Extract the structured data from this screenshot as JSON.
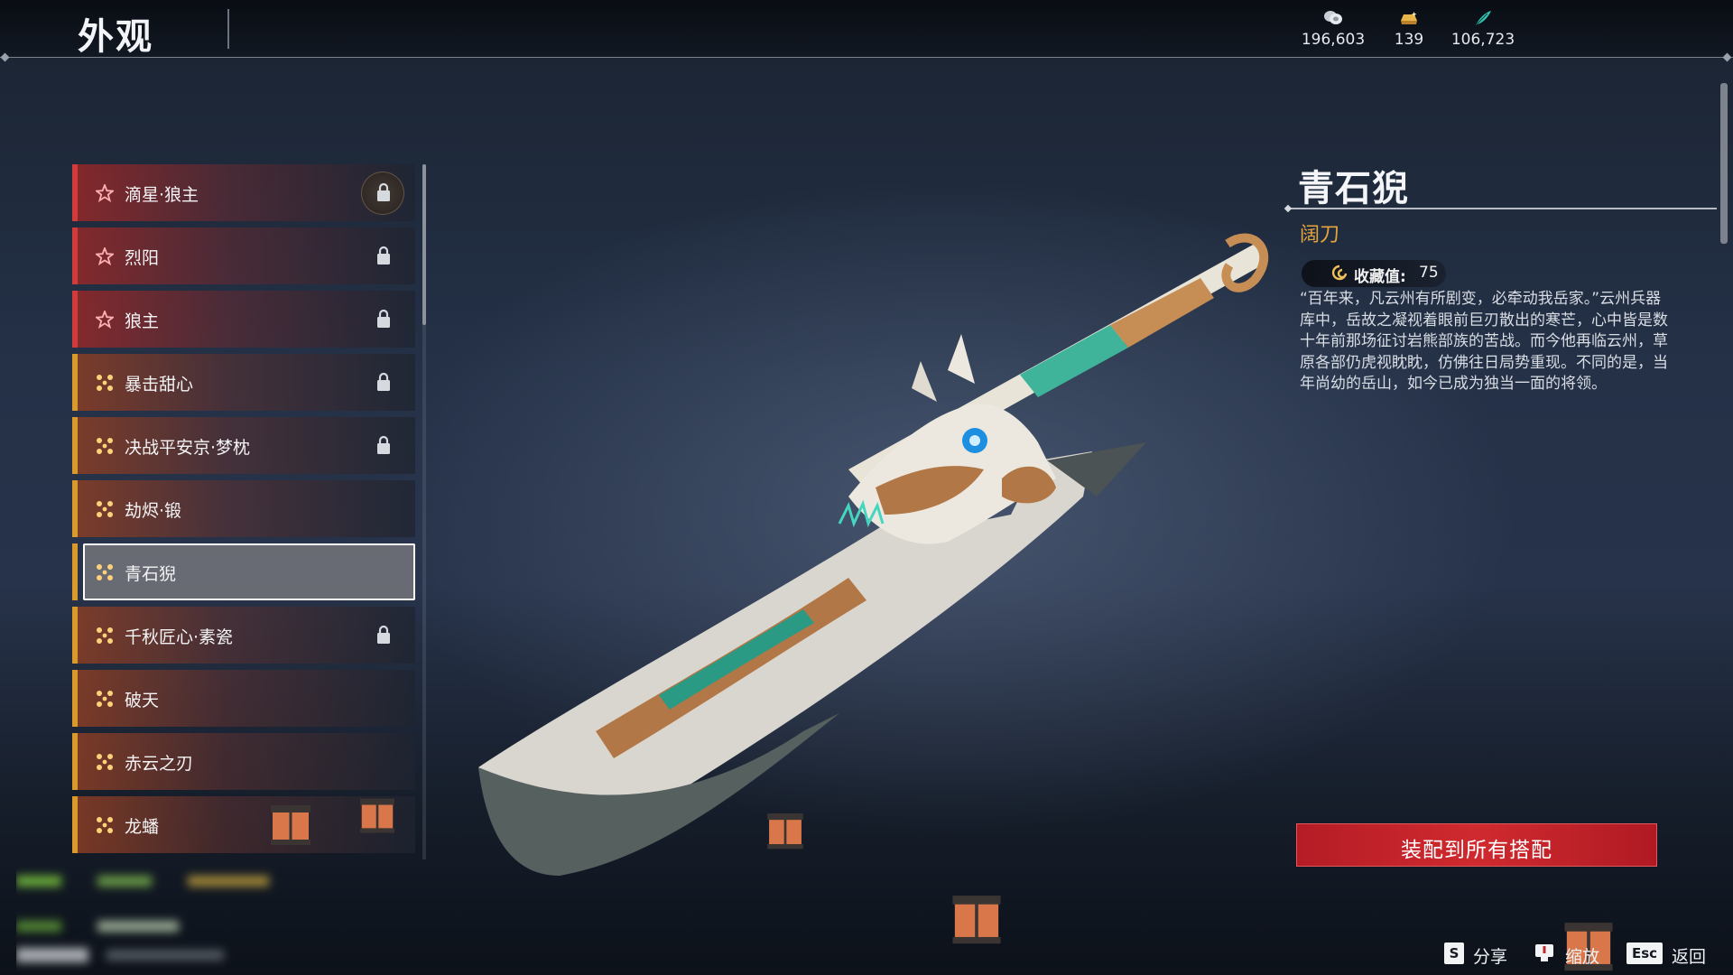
{
  "header": {
    "title": "外观",
    "currencies": [
      {
        "icon": "coin-stack-icon",
        "value": "196,603"
      },
      {
        "icon": "gold-ingot-icon",
        "value": "139"
      },
      {
        "icon": "jade-feather-icon",
        "value": "106,723"
      }
    ]
  },
  "skins": [
    {
      "name": "滴星·狼主",
      "rarity": "red",
      "locked": true
    },
    {
      "name": "烈阳",
      "rarity": "red",
      "locked": true
    },
    {
      "name": "狼主",
      "rarity": "red",
      "locked": true
    },
    {
      "name": "暴击甜心",
      "rarity": "gold",
      "locked": true
    },
    {
      "name": "决战平安京·梦枕",
      "rarity": "gold",
      "locked": true
    },
    {
      "name": "劫烬·锻",
      "rarity": "gold",
      "locked": false
    },
    {
      "name": "青石猊",
      "rarity": "gold",
      "locked": false,
      "selected": true
    },
    {
      "name": "千秋匠心·素瓷",
      "rarity": "gold",
      "locked": true
    },
    {
      "name": "破天",
      "rarity": "gold",
      "locked": false
    },
    {
      "name": "赤云之刃",
      "rarity": "gold",
      "locked": false
    },
    {
      "name": "龙蟠",
      "rarity": "gold",
      "locked": false
    }
  ],
  "detail": {
    "name": "青石猊",
    "type": "阔刀",
    "collect_label": "收藏值:",
    "collect_value": "75",
    "lore": "“百年来，凡云州有所剧变，必牵动我岳家。”云州兵器库中，岳故之凝视着眼前巨刃散出的寒芒，心中皆是数十年前那场征讨岩熊部族的苦战。而今他再临云州，草原各部仍虎视眈眈，仿佛往日局势重现。不同的是，当年尚幼的岳山，如今已成为独当一面的将领。",
    "equip_button": "装配到所有搭配"
  },
  "hints": [
    {
      "key": "S",
      "label": "分享"
    },
    {
      "key": "",
      "label": "缩放"
    },
    {
      "key": "Esc",
      "label": "返回"
    }
  ],
  "colors": {
    "accent_red": "#d23b3b",
    "accent_gold": "#d99a2b",
    "button_red": "#c8242b",
    "type_gold": "#e6a53c"
  }
}
